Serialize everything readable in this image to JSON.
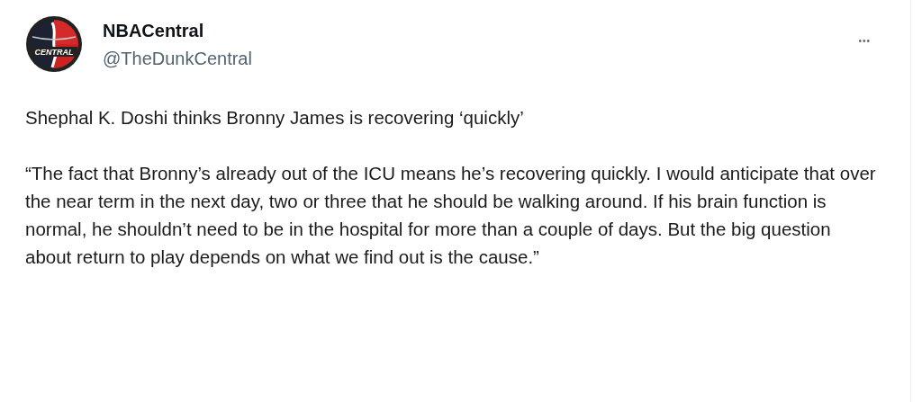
{
  "author": {
    "name": "NBACentral",
    "handle": "@TheDunkCentral",
    "avatar_label": "CENTRAL"
  },
  "more_button": "•••",
  "paragraphs": [
    "Shephal K. Doshi thinks Bronny James is recovering ‘quickly’",
    "“The fact that Bronny’s already out of the ICU means he’s recovering quickly. I would anticipate that over the near term in the next day, two or three that he should be walking around. If his brain function is normal, he shouldn’t need to be in the hospital for more than a couple of days. But the big question about return to play depends on what we find out is the cause.”"
  ]
}
